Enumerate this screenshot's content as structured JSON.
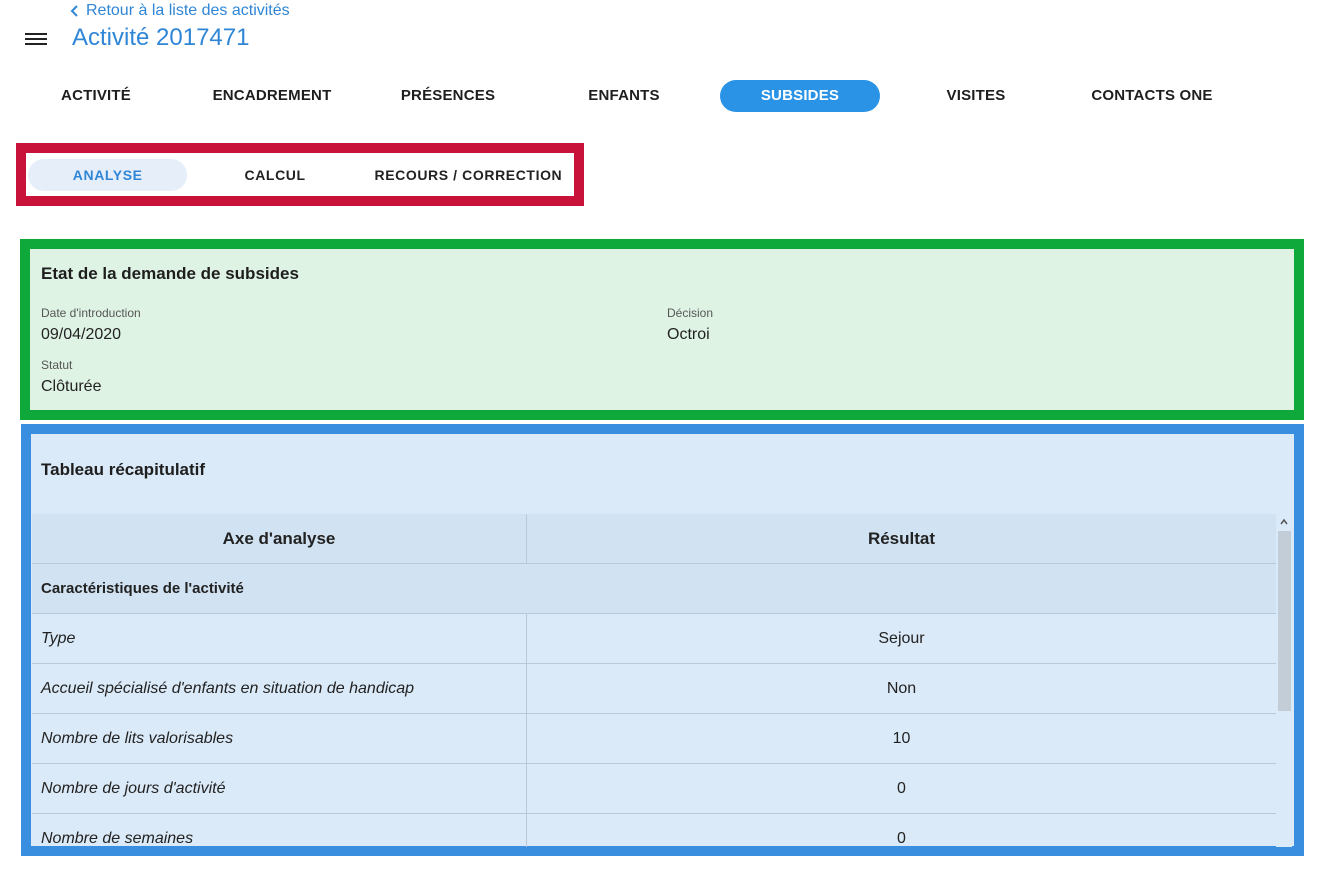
{
  "header": {
    "back_label": "Retour à la liste des activités",
    "title": "Activité 2017471"
  },
  "tabs": [
    {
      "label": "ACTIVITÉ"
    },
    {
      "label": "ENCADREMENT"
    },
    {
      "label": "PRÉSENCES"
    },
    {
      "label": "ENFANTS"
    },
    {
      "label": "SUBSIDES",
      "active": true
    },
    {
      "label": "VISITES"
    },
    {
      "label": "CONTACTS ONE"
    }
  ],
  "subtabs": [
    {
      "label": "ANALYSE",
      "active": true
    },
    {
      "label": "CALCUL"
    },
    {
      "label": "RECOURS / CORRECTION"
    }
  ],
  "status_card": {
    "title": "Etat de la demande de subsides",
    "date_label": "Date d'introduction",
    "date_value": "09/04/2020",
    "decision_label": "Décision",
    "decision_value": "Octroi",
    "statut_label": "Statut",
    "statut_value": "Clôturée"
  },
  "summary_table": {
    "title": "Tableau récapitulatif",
    "headers": [
      "Axe d'analyse",
      "Résultat"
    ],
    "section": "Caractéristiques de l'activité",
    "rows": [
      {
        "axe": "Type",
        "resultat": "Sejour"
      },
      {
        "axe": "Accueil spécialisé d'enfants en situation de handicap",
        "resultat": "Non"
      },
      {
        "axe": "Nombre de lits valorisables",
        "resultat": "10"
      },
      {
        "axe": "Nombre de jours d'activité",
        "resultat": "0"
      },
      {
        "axe": "Nombre de semaines",
        "resultat": "0"
      }
    ]
  },
  "colors": {
    "accent": "#2b93e6",
    "subtabs_frame": "#c8123a",
    "status_frame": "#0fa83a",
    "table_frame": "#3a8ee0"
  }
}
